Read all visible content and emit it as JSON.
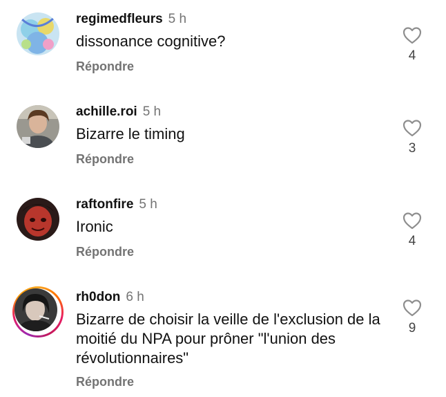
{
  "comments": [
    {
      "username": "regimedfleurs",
      "time": "5 h",
      "text": "dissonance cognitive?",
      "likes": "4",
      "reply_label": "Répondre",
      "avatar": "avatar-art"
    },
    {
      "username": "achille.roi",
      "time": "5 h",
      "text": "Bizarre le timing",
      "likes": "3",
      "reply_label": "Répondre",
      "avatar": "avatar-photo"
    },
    {
      "username": "raftonfire",
      "time": "5 h",
      "text": "Ironic",
      "likes": "4",
      "reply_label": "Répondre",
      "avatar": "avatar-art"
    },
    {
      "username": "rh0don",
      "time": "6 h",
      "text": "Bizarre de choisir la veille de l'exclusion de la moitié du NPA pour prôner \"l'union des révolutionnaires\"",
      "likes": "9",
      "reply_label": "Répondre",
      "avatar": "avatar-photo-story"
    }
  ],
  "icons": {
    "like": "heart-outline-icon"
  },
  "colors": {
    "secondary_text": "#737373",
    "story_ring": "#e91e63"
  }
}
